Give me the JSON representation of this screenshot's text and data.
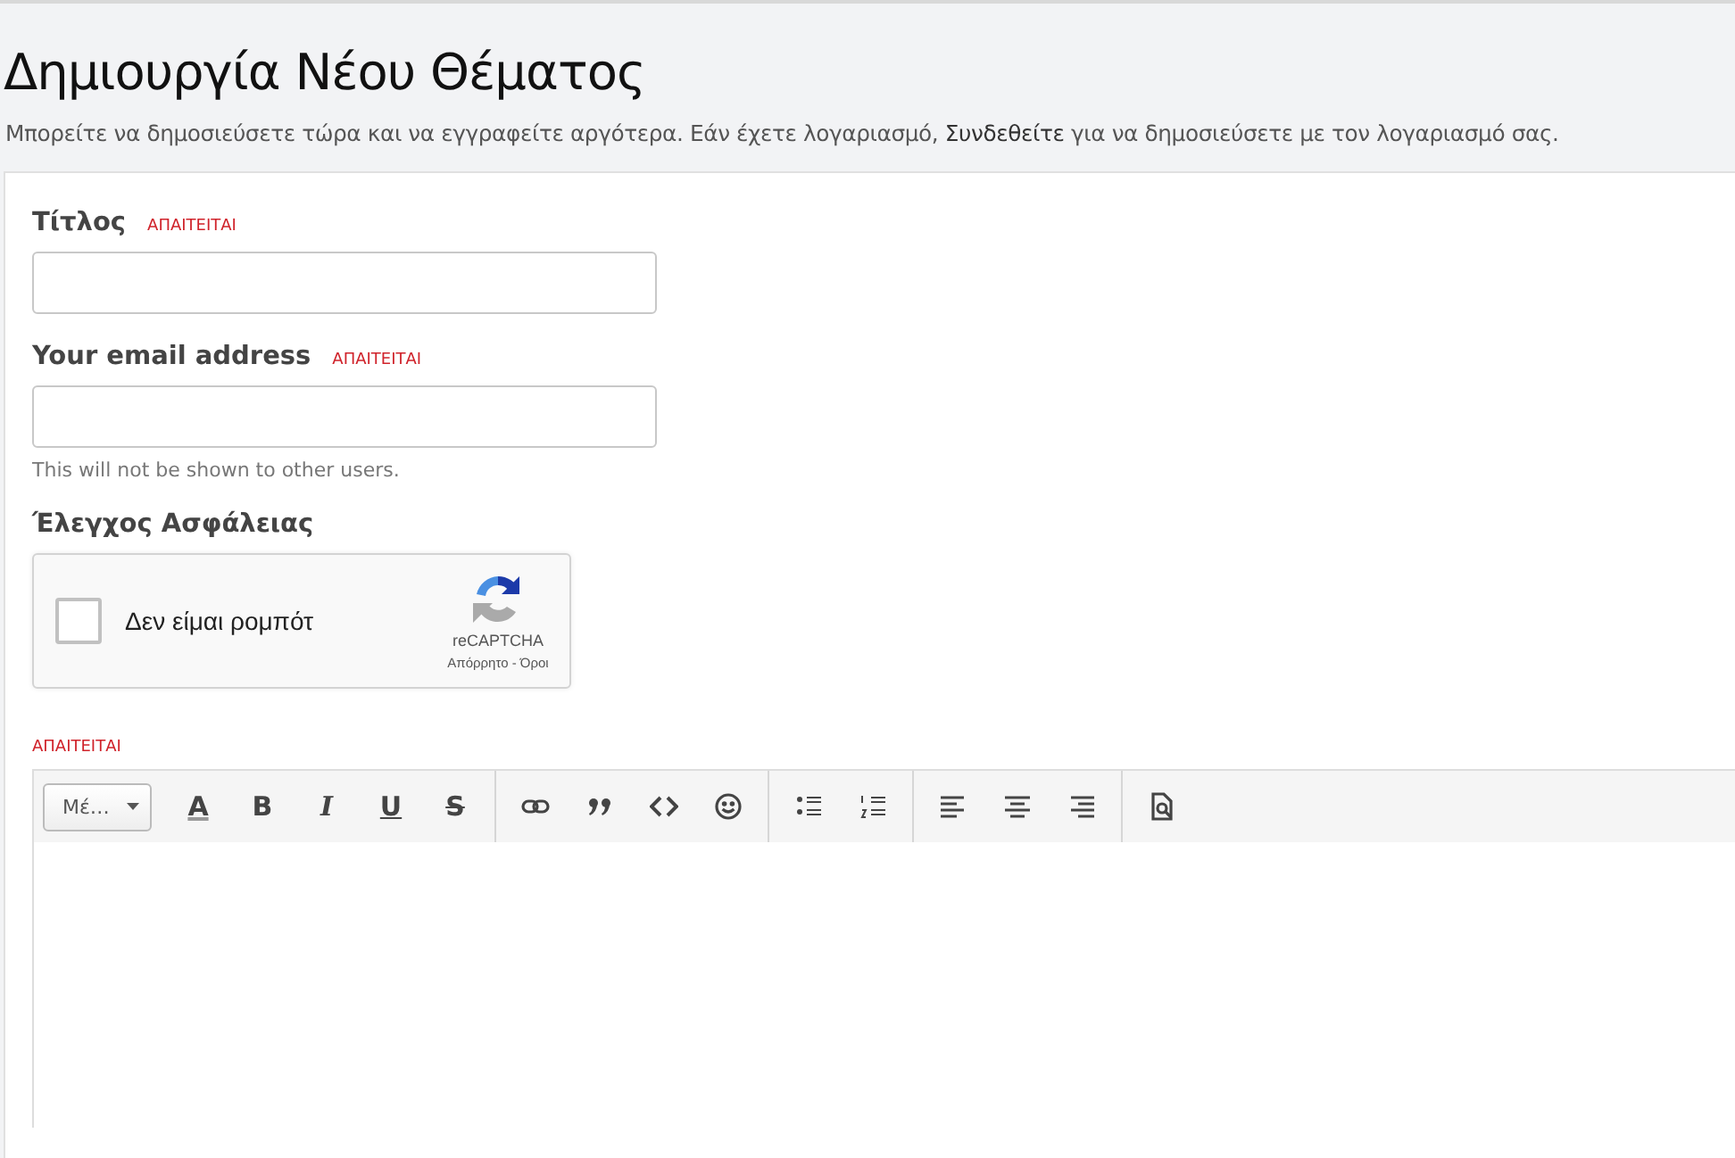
{
  "page_title": "Δημιουργία Νέου Θέματος",
  "intro": "Μπορείτε να δημοσιεύσετε τώρα και να εγγραφείτε αργότερα. Εάν έχετε λογαριασμό, ",
  "intro_link": "Συνδεθείτε",
  "intro_end": " για να δημοσιεύσετε με τον λογαριασμό σας.",
  "fields": [
    {
      "label": "Τίτλος",
      "required": "ΑΠΑΙΤΕΙΤΑΙ"
    },
    {
      "label": "Your email address",
      "required": "ΑΠΑΙΤΕΙΤΑΙ",
      "hint": "This will not be shown to other users."
    }
  ],
  "captcha": {
    "label": "Έλεγχος Ασφάλειας",
    "checkbox_label": "Δεν είμαι ρομπότ",
    "checked": false,
    "brand": "reCAPTCHA",
    "privacy": "Απόρρητο",
    "separator": " - ",
    "terms": "Όροι"
  },
  "editor": {
    "required": "ΑΠΑΙΤΕΙΤΑΙ",
    "format": "Μέ…",
    "groups": [
      [
        {
          "kind": "color",
          "text": "A"
        },
        {
          "kind": "bold",
          "text": "B"
        },
        {
          "kind": "italic",
          "text": "I"
        },
        {
          "kind": "underline",
          "text": "U"
        },
        {
          "kind": "strike",
          "text": "S"
        }
      ],
      [
        {
          "kind": "link"
        },
        {
          "kind": "quote"
        },
        {
          "kind": "code"
        },
        {
          "kind": "emoji"
        }
      ],
      [
        {
          "kind": "bullets"
        },
        {
          "kind": "numbers"
        }
      ],
      [
        {
          "kind": "align-left"
        },
        {
          "kind": "align-center"
        },
        {
          "kind": "align-right"
        }
      ],
      [
        {
          "kind": "preview"
        }
      ]
    ]
  }
}
